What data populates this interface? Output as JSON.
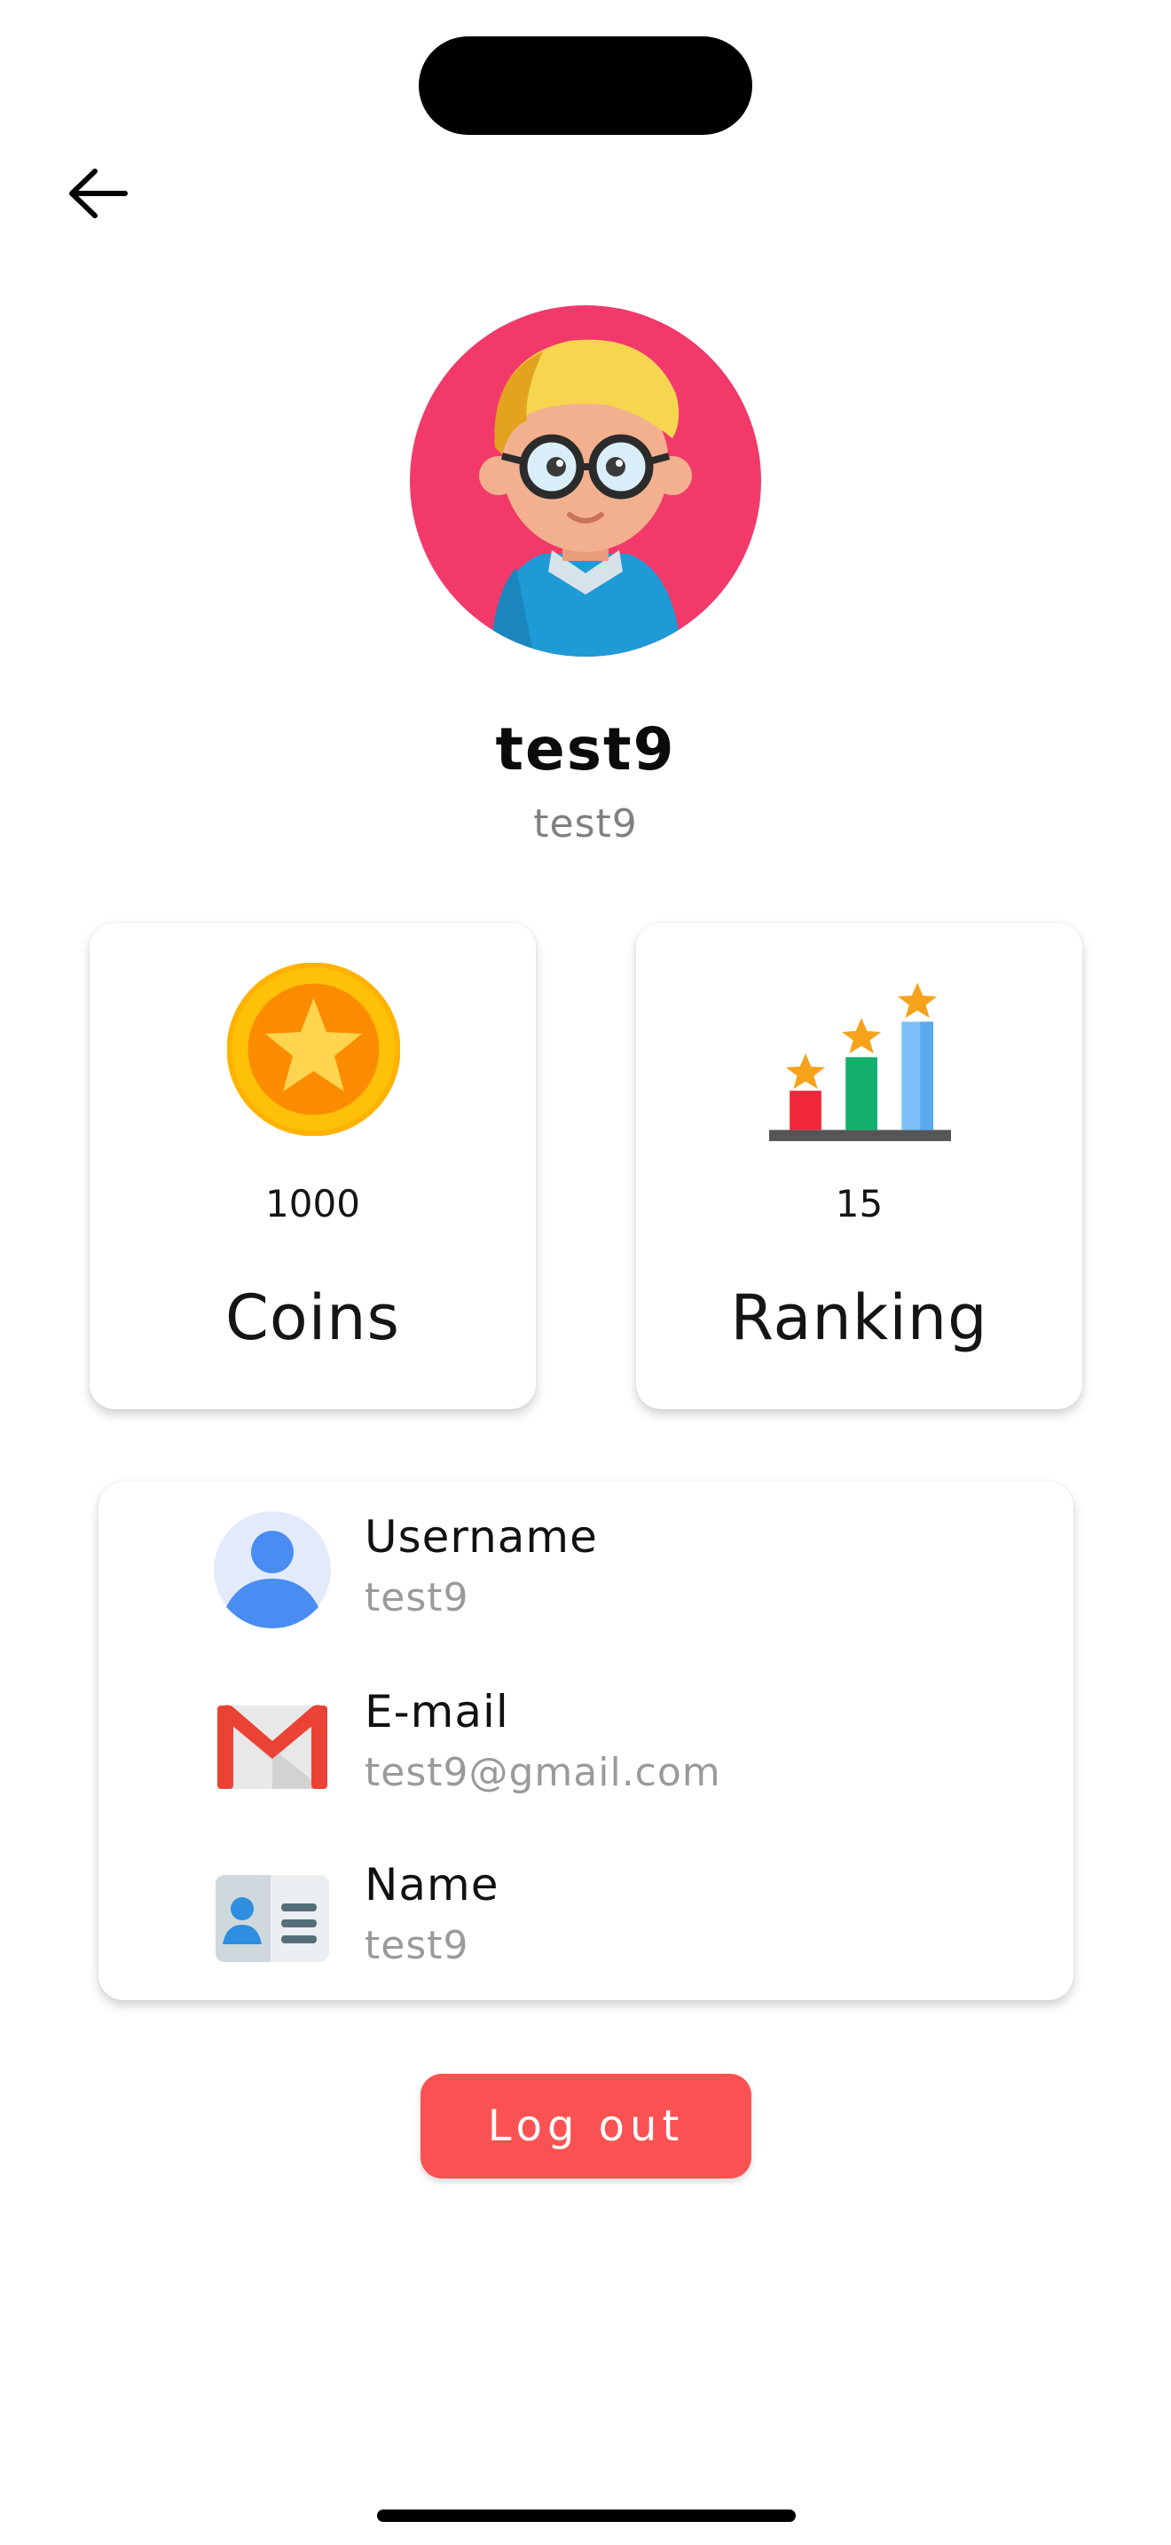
{
  "profile": {
    "display_name": "test9",
    "sub_name": "test9"
  },
  "stats": {
    "coins": {
      "value": "1000",
      "label": "Coins",
      "icon": "coin-star-icon"
    },
    "ranking": {
      "value": "15",
      "label": "Ranking",
      "icon": "ranking-chart-icon"
    }
  },
  "info": [
    {
      "title": "Username",
      "value": "test9",
      "icon": "user-icon"
    },
    {
      "title": "E-mail",
      "value": "test9@gmail.com",
      "icon": "gmail-icon"
    },
    {
      "title": "Name",
      "value": "test9",
      "icon": "id-card-icon"
    }
  ],
  "actions": {
    "logout_label": "Log out"
  },
  "colors": {
    "avatar_bg": "#f23a6a",
    "logout_bg": "#fa5252"
  }
}
